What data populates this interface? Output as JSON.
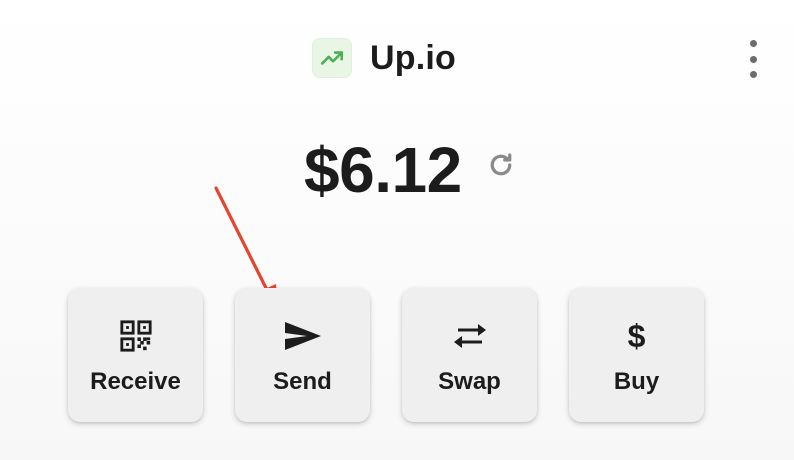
{
  "header": {
    "app_name": "Up.io",
    "logo_icon": "trending-up-icon",
    "logo_color": "#4caf50",
    "menu_icon": "more-vertical-icon"
  },
  "wallet": {
    "balance": "$6.12",
    "refresh_icon": "refresh-icon"
  },
  "actions": [
    {
      "label": "Receive",
      "icon": "qr-code-icon"
    },
    {
      "label": "Send",
      "icon": "send-icon"
    },
    {
      "label": "Swap",
      "icon": "swap-arrows-icon"
    },
    {
      "label": "Buy",
      "icon": "dollar-icon",
      "glyph": "$"
    }
  ],
  "annotation": {
    "color": "#e8432d",
    "target": "Send"
  }
}
